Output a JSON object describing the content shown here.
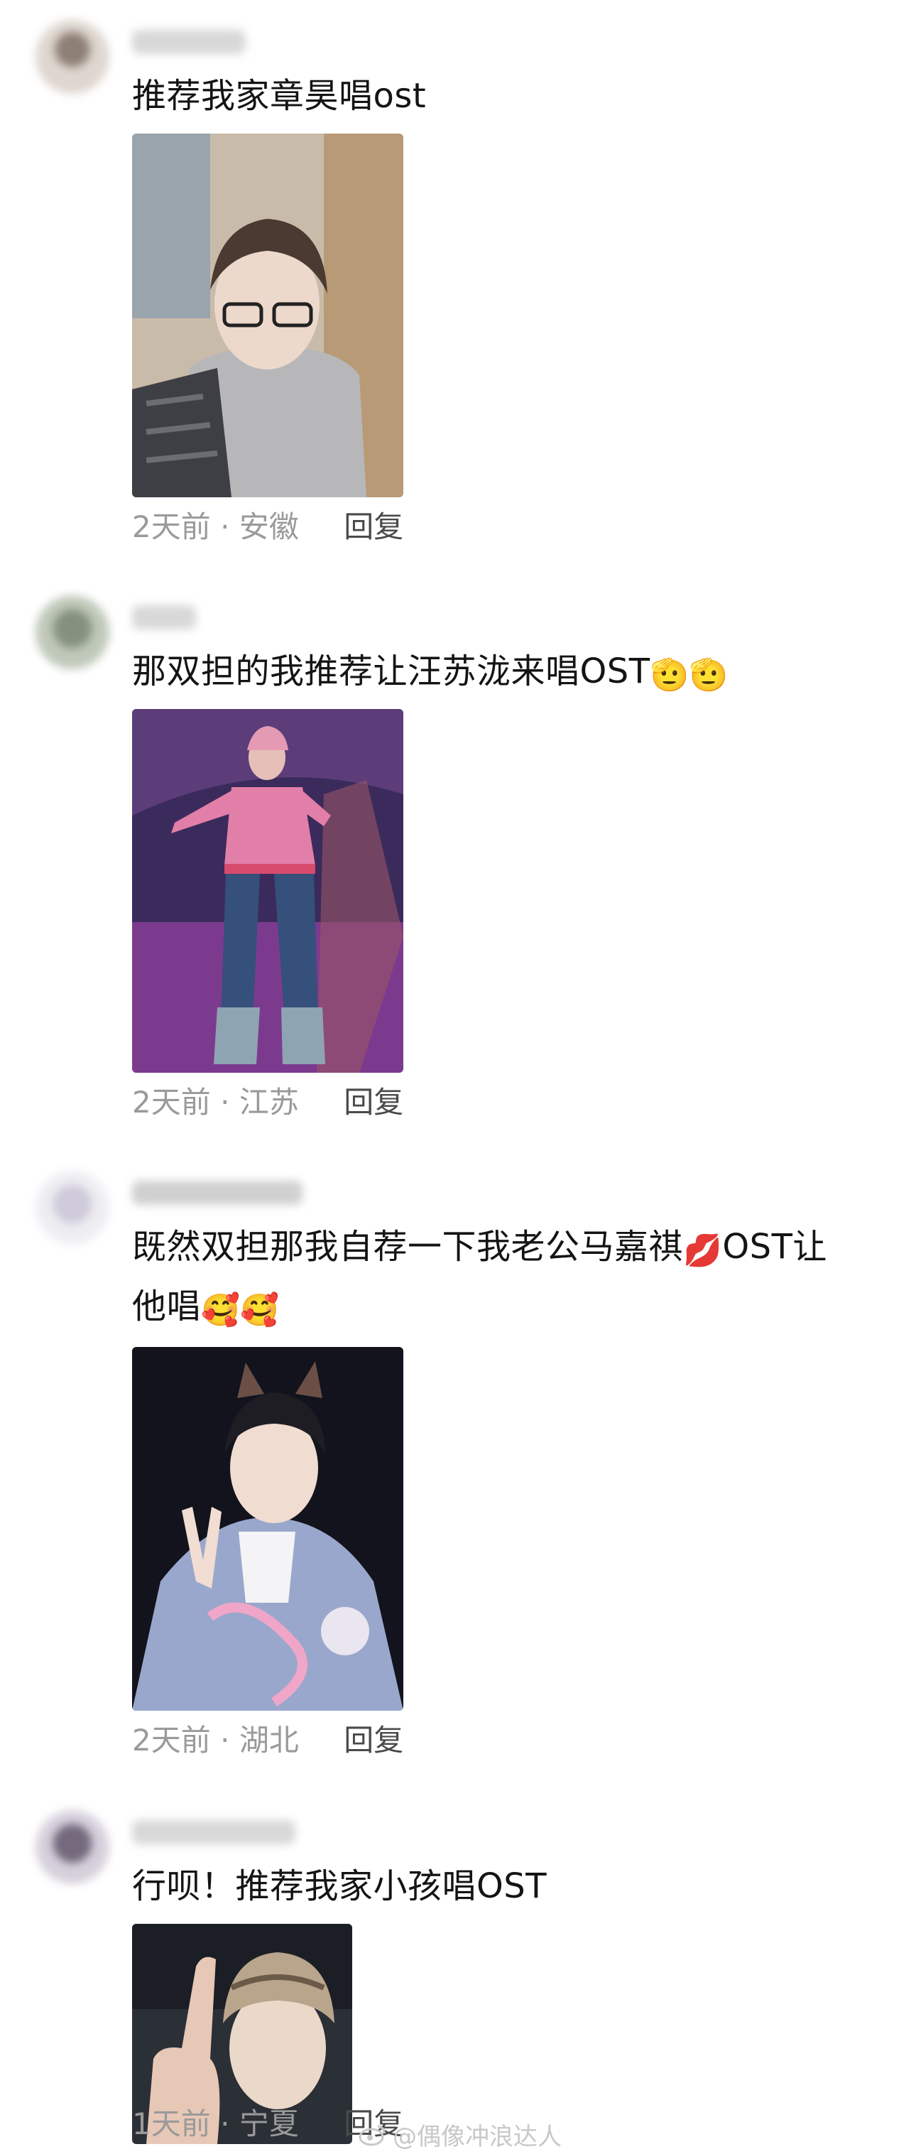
{
  "comments": [
    {
      "text": "推荐我家章昊唱ost",
      "time": "2天前",
      "location": "安徽",
      "reply_label": "回复"
    },
    {
      "text": "那双担的我推荐让汪苏泷来唱OST",
      "emojis": [
        "🫡",
        "🫡"
      ],
      "time": "2天前",
      "location": "江苏",
      "reply_label": "回复"
    },
    {
      "text_line1": "既然双担那我自荐一下我老公马嘉祺",
      "text_line1_tail": "OST让",
      "text_line2": "他唱",
      "emojis": [
        "💋",
        "🥰",
        "🥰"
      ],
      "time": "2天前",
      "location": "湖北",
      "reply_label": "回复"
    },
    {
      "text": "行呗！推荐我家小孩唱OST",
      "time": "1天前",
      "location": "宁夏",
      "reply_label": "回复"
    }
  ],
  "meta_separator": "·",
  "watermark": "@偶像冲浪达人"
}
